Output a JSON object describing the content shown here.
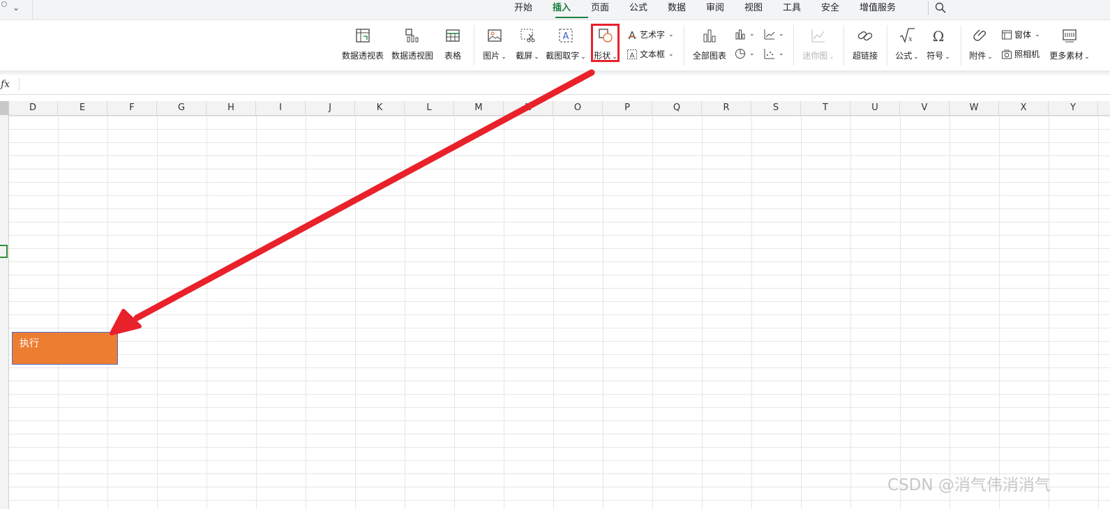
{
  "menu": {
    "tabs": [
      {
        "label": "开始"
      },
      {
        "label": "插入",
        "active": true
      },
      {
        "label": "页面"
      },
      {
        "label": "公式"
      },
      {
        "label": "数据"
      },
      {
        "label": "审阅"
      },
      {
        "label": "视图"
      },
      {
        "label": "工具"
      },
      {
        "label": "安全"
      },
      {
        "label": "增值服务"
      }
    ]
  },
  "ribbon": {
    "pivot_table": "数据透视表",
    "pivot_chart": "数据透视图",
    "table": "表格",
    "picture": "图片",
    "screenshot": "截屏",
    "ocr": "截图取字",
    "shape": "形状",
    "wordart": "艺术字",
    "textbox": "文本框",
    "all_charts": "全部图表",
    "sparkline": "迷你图",
    "hyperlink": "超链接",
    "formula": "公式",
    "symbol": "符号",
    "attachment": "附件",
    "form": "窗体",
    "camera": "照相机",
    "more": "更多素材",
    "caret": "⌄"
  },
  "formula_bar": {
    "fx": "fx"
  },
  "columns": [
    "D",
    "E",
    "F",
    "G",
    "H",
    "I",
    "J",
    "K",
    "L",
    "M",
    "N",
    "O",
    "P",
    "Q",
    "R",
    "S",
    "T",
    "U",
    "V",
    "W",
    "X",
    "Y"
  ],
  "shape_text": "执行",
  "watermark": "CSDN @消气伟消消气",
  "colors": {
    "accent": "#1a7f3c",
    "highlight": "#e8212b",
    "shape_fill": "#ed7d31",
    "shape_border": "#4f6bcf"
  }
}
